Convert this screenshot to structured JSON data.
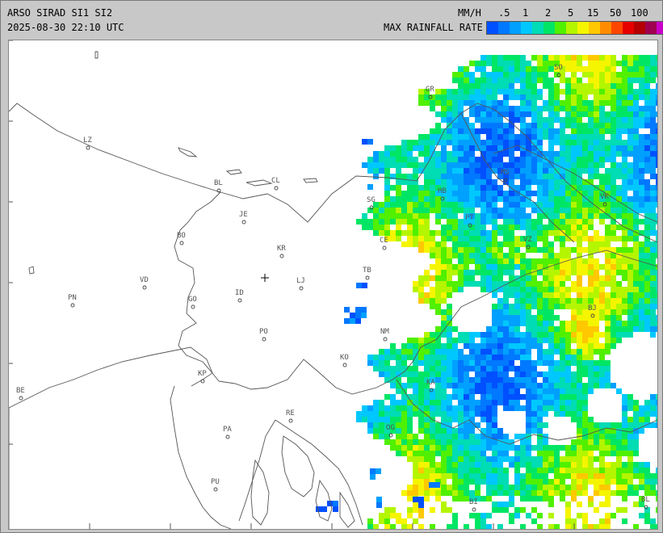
{
  "header": {
    "line1": "ARSO SIRAD SI1 SI2",
    "line2": "2025-08-30 22:10 UTC",
    "unit": "MM/H",
    "legend_title": "MAX RAINFALL RATE"
  },
  "scale": {
    "ticks": [
      ".5",
      "1",
      "2",
      "5",
      "15",
      "50",
      "100"
    ],
    "colors": [
      "#0050ff",
      "#0078ff",
      "#00a0ff",
      "#00c8ff",
      "#00dcb4",
      "#00e664",
      "#50f000",
      "#b4f500",
      "#f5f500",
      "#ffc800",
      "#ff8c00",
      "#ff4600",
      "#e60000",
      "#b40000",
      "#a00050",
      "#c800c8"
    ]
  },
  "places": [
    {
      "code": "GR"
    },
    {
      "code": "SO"
    },
    {
      "code": "LZ"
    },
    {
      "code": "BL"
    },
    {
      "code": "CL"
    },
    {
      "code": "HB"
    },
    {
      "code": "MS"
    },
    {
      "code": "VK"
    },
    {
      "code": "JE"
    },
    {
      "code": "SG"
    },
    {
      "code": "PT"
    },
    {
      "code": "BO"
    },
    {
      "code": "KR"
    },
    {
      "code": "CE"
    },
    {
      "code": "VZ"
    },
    {
      "code": "VD"
    },
    {
      "code": "LJ"
    },
    {
      "code": "TB"
    },
    {
      "code": "PN"
    },
    {
      "code": "GO"
    },
    {
      "code": "ID"
    },
    {
      "code": "BJ"
    },
    {
      "code": "NM"
    },
    {
      "code": "PO"
    },
    {
      "code": "KO"
    },
    {
      "code": "KP"
    },
    {
      "code": "KA"
    },
    {
      "code": "BE"
    },
    {
      "code": "RE"
    },
    {
      "code": "PA"
    },
    {
      "code": "OG"
    },
    {
      "code": "PU"
    },
    {
      "code": "BI"
    },
    {
      "code": "BL"
    }
  ],
  "colors": {
    "frame": "#c8c8c8",
    "map_bg": "#ffffff",
    "border_line": "#555555"
  }
}
